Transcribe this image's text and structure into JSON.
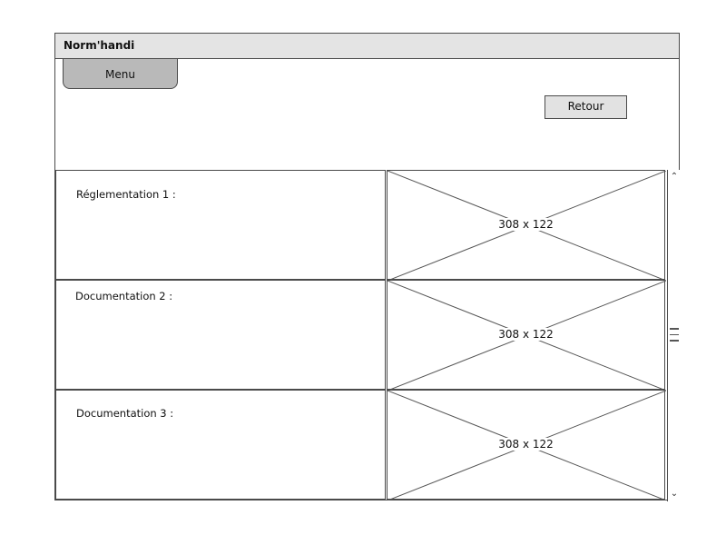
{
  "window": {
    "title": "Norm'handi"
  },
  "header": {
    "menu_label": "Menu",
    "back_label": "Retour"
  },
  "items": [
    {
      "label": "Réglementation 1 :",
      "image_caption": "308 x 122"
    },
    {
      "label": "Documentation 2 :",
      "image_caption": "308 x 122"
    },
    {
      "label": "Documentation 3 :",
      "image_caption": "308 x 122"
    }
  ],
  "scrollbar": {
    "up_icon": "chevron-up-icon",
    "down_icon": "chevron-down-icon"
  }
}
